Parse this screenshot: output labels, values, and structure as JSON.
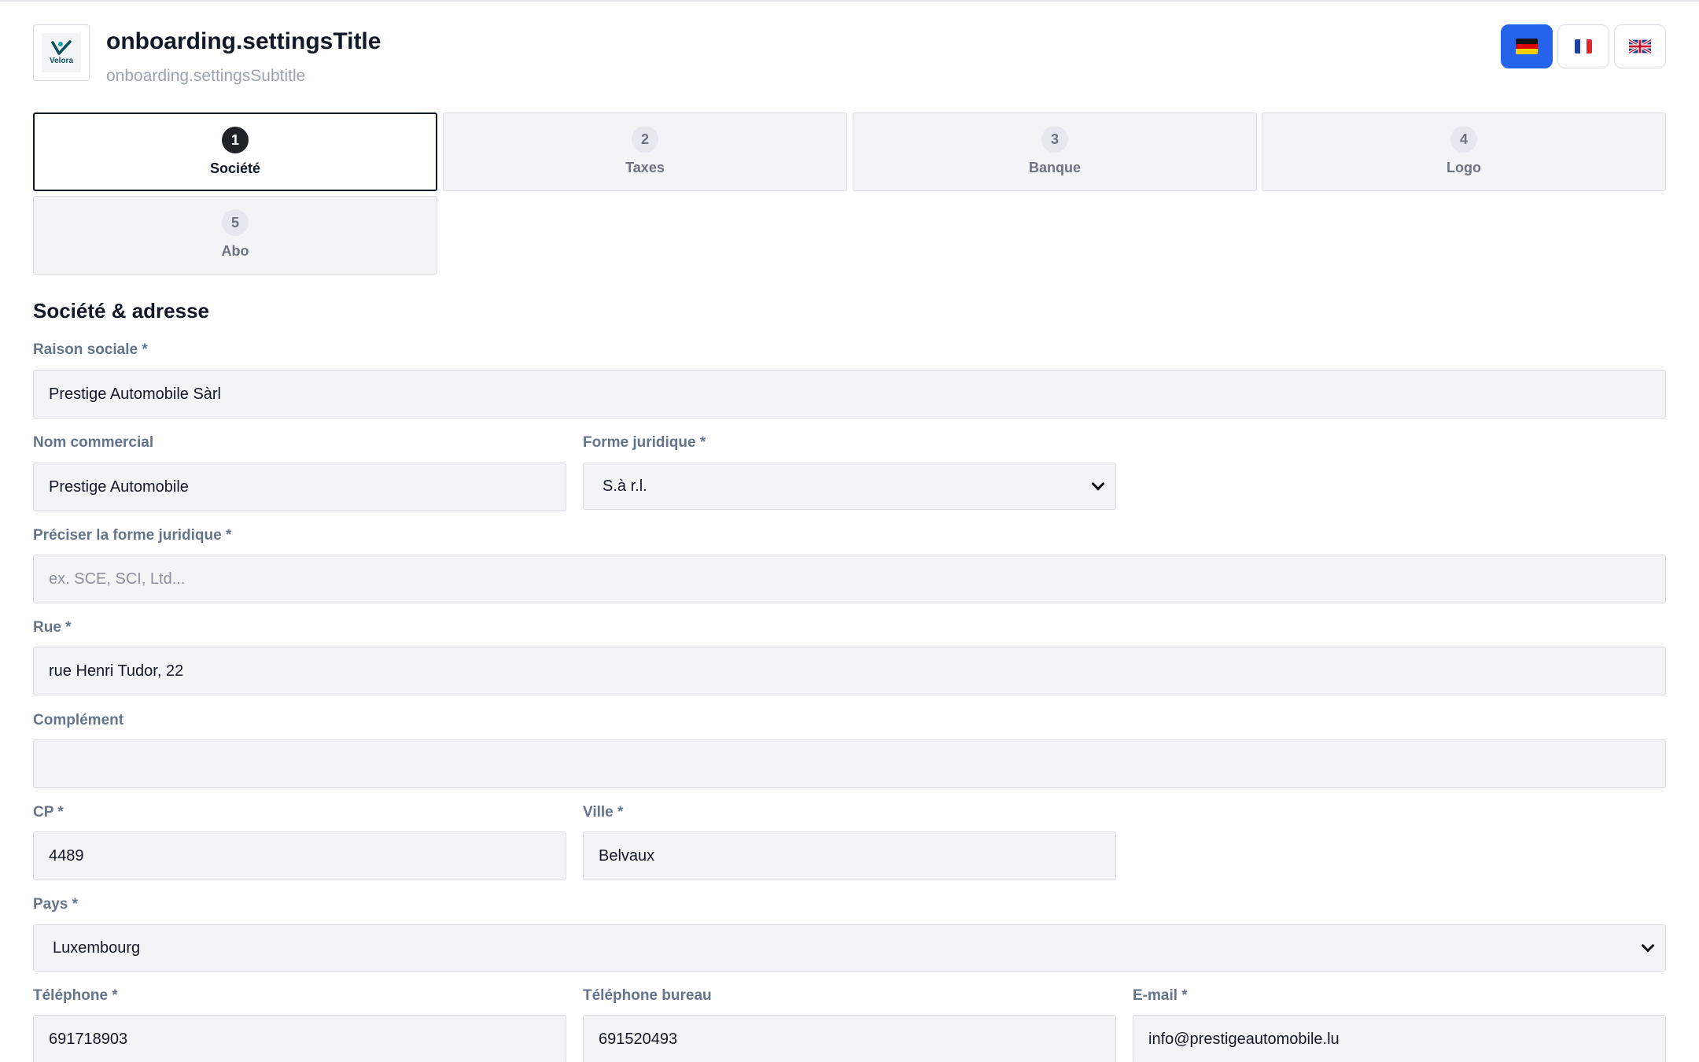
{
  "header": {
    "title": "onboarding.settingsTitle",
    "subtitle": "onboarding.settingsSubtitle",
    "logo_text": "Velora"
  },
  "languages": [
    {
      "code": "de",
      "icon": "flag-de-icon",
      "active": true
    },
    {
      "code": "fr",
      "icon": "flag-fr-icon",
      "active": false
    },
    {
      "code": "gb",
      "icon": "flag-gb-icon",
      "active": false
    }
  ],
  "steps": [
    {
      "number": "1",
      "label": "Société",
      "active": true
    },
    {
      "number": "2",
      "label": "Taxes",
      "active": false
    },
    {
      "number": "3",
      "label": "Banque",
      "active": false
    },
    {
      "number": "4",
      "label": "Logo",
      "active": false
    },
    {
      "number": "5",
      "label": "Abo",
      "active": false
    }
  ],
  "form": {
    "section_title": "Société & adresse",
    "company_name": {
      "label": "Raison sociale *",
      "value": "Prestige Automobile Sàrl"
    },
    "trade_name": {
      "label": "Nom commercial",
      "value": "Prestige Automobile"
    },
    "legal_form": {
      "label": "Forme juridique *",
      "selected": "S.à r.l."
    },
    "legal_form_detail": {
      "label": "Préciser la forme juridique *",
      "value": "",
      "placeholder": "ex. SCE, SCI, Ltd..."
    },
    "street": {
      "label": "Rue *",
      "value": "rue Henri Tudor, 22"
    },
    "complement": {
      "label": "Complément",
      "value": ""
    },
    "postcode": {
      "label": "CP *",
      "value": "4489"
    },
    "city": {
      "label": "Ville *",
      "value": "Belvaux"
    },
    "country": {
      "label": "Pays *",
      "selected": "Luxembourg"
    },
    "phone": {
      "label": "Téléphone *",
      "value": "691718903"
    },
    "office_phone": {
      "label": "Téléphone bureau",
      "value": "691520493"
    },
    "email": {
      "label": "E-mail *",
      "value": "info@prestigeautomobile.lu"
    }
  },
  "colors": {
    "accent": "#2563eb",
    "active_step": "#1f2328",
    "label": "#64748b",
    "field_bg": "#f3f4f6"
  }
}
